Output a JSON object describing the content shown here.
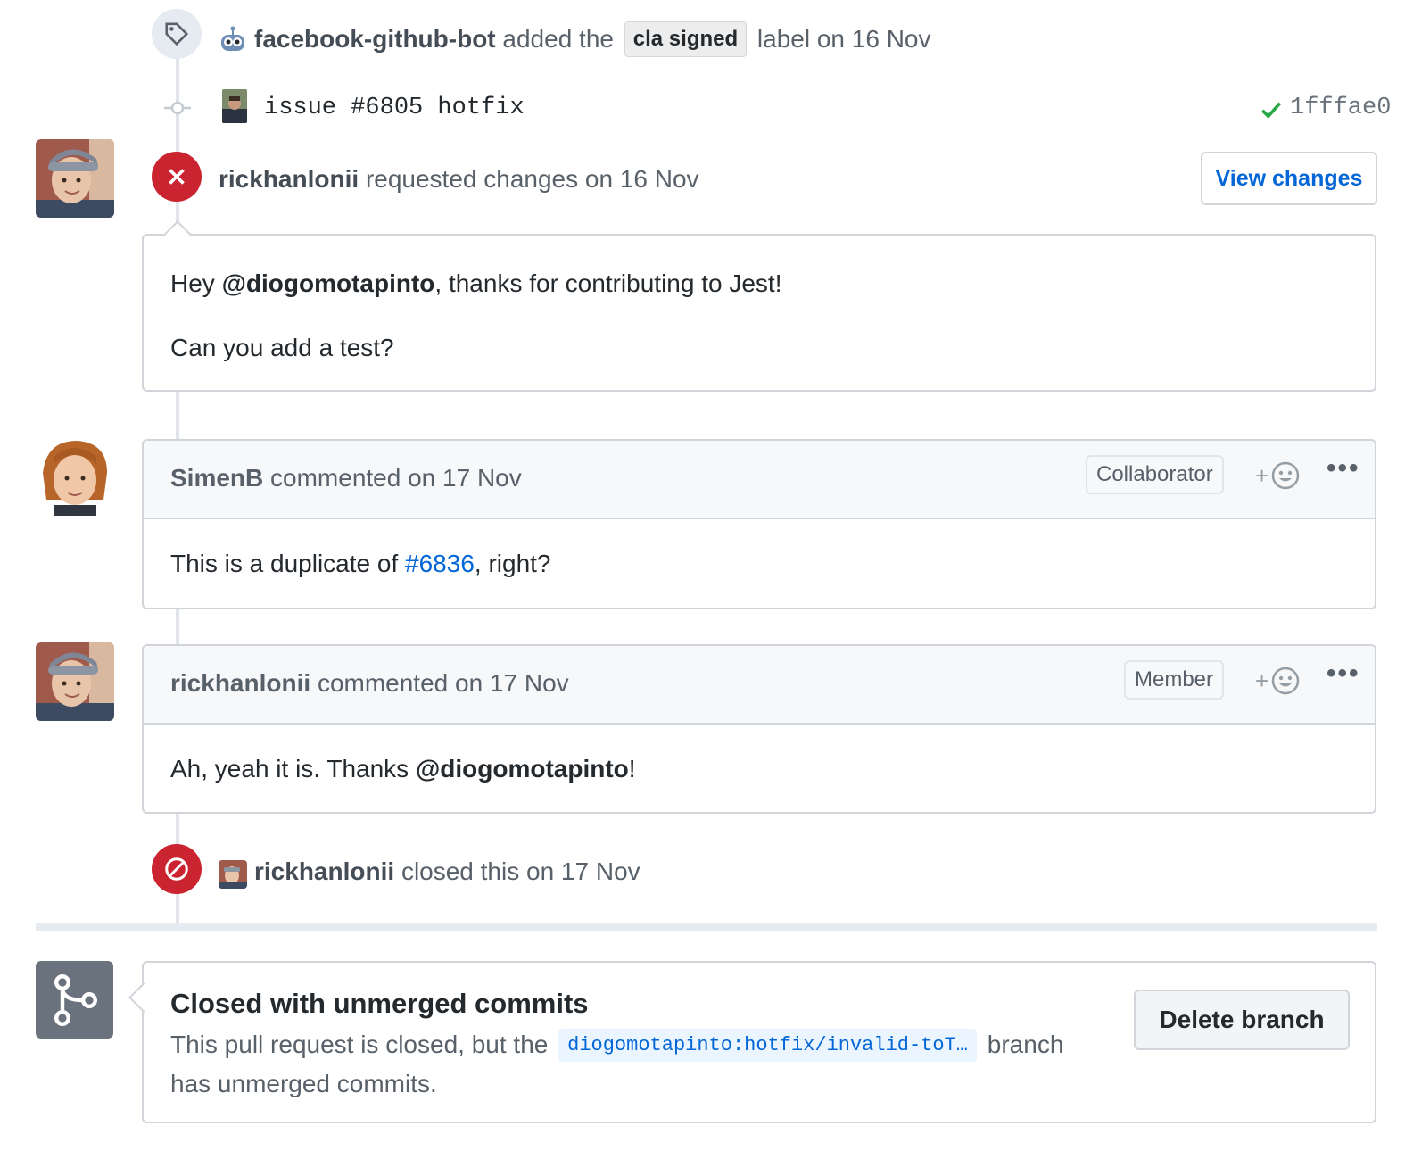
{
  "events": {
    "label_added": {
      "actor": "facebook-github-bot",
      "text_before": "added the",
      "label": "cla signed",
      "text_after": "label on 16 Nov"
    },
    "commit": {
      "message": "issue #6805 hotfix",
      "sha": "1fffae0",
      "status": "success"
    },
    "review": {
      "actor": "rickhanlonii",
      "action": "requested changes on 16 Nov",
      "button": "View changes",
      "greeting": "Hey",
      "mention": "@diogomotapinto",
      "line1_rest": ", thanks for contributing to Jest!",
      "line2": "Can you add a test?"
    },
    "closed": {
      "actor": "rickhanlonii",
      "action": "closed this on 17 Nov"
    }
  },
  "comments": [
    {
      "author": "SimenB",
      "meta": "commented on 17 Nov",
      "role": "Collaborator",
      "react": "+",
      "more": "•••",
      "body_before": "This is a duplicate of",
      "body_link": "#6836",
      "body_after": ", right?"
    },
    {
      "author": "rickhanlonii",
      "meta": "commented on 17 Nov",
      "role": "Member",
      "react": "+",
      "more": "•••",
      "body_before": "Ah, yeah it is. Thanks",
      "body_mention": "@diogomotapinto",
      "body_after": "!"
    }
  ],
  "merge_box": {
    "title": "Closed with unmerged commits",
    "desc_before": "This pull request is closed, but the",
    "branch": "diogomotapinto:hotfix/invalid-toT…",
    "desc_after": "branch",
    "desc_line2": "has unmerged commits.",
    "button": "Delete branch"
  },
  "colors": {
    "danger": "#cb2431",
    "link": "#0366d6",
    "success": "#28a745",
    "muted_gray": "#6a737d"
  },
  "icons": [
    "tag-icon",
    "commit-icon",
    "x-icon",
    "check-icon",
    "blocked-icon",
    "smiley-icon",
    "kebab-icon",
    "git-branch-icon",
    "bot-icon"
  ]
}
